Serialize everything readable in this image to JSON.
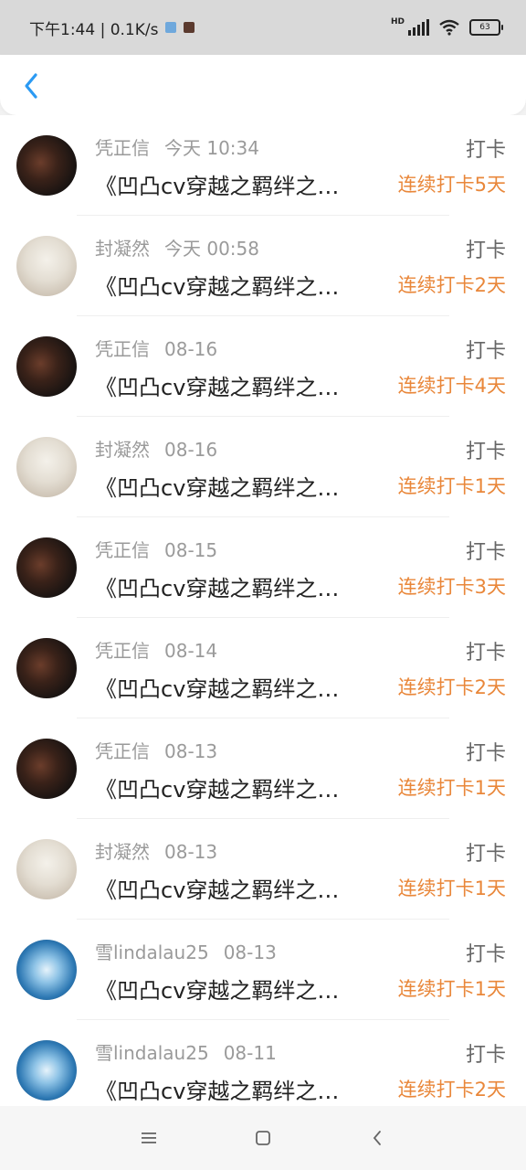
{
  "status_bar": {
    "time_speed": "下午1:44 | 0.1K/s",
    "network": "HD",
    "battery": "63"
  },
  "header": {
    "back_icon": "chevron-left-icon"
  },
  "colors": {
    "accent": "#e9873a",
    "back_icon": "#2b9af3"
  },
  "entries": [
    {
      "user": "凭正信",
      "date": "今天 10:34",
      "title": "《凹凸cv穿越之羁绊之…",
      "type": "打卡",
      "streak": "连续打卡5天",
      "avatar": "dark"
    },
    {
      "user": "封凝然",
      "date": "今天 00:58",
      "title": "《凹凸cv穿越之羁绊之…",
      "type": "打卡",
      "streak": "连续打卡2天",
      "avatar": "light"
    },
    {
      "user": "凭正信",
      "date": "08-16",
      "title": "《凹凸cv穿越之羁绊之…",
      "type": "打卡",
      "streak": "连续打卡4天",
      "avatar": "dark"
    },
    {
      "user": "封凝然",
      "date": "08-16",
      "title": "《凹凸cv穿越之羁绊之…",
      "type": "打卡",
      "streak": "连续打卡1天",
      "avatar": "light"
    },
    {
      "user": "凭正信",
      "date": "08-15",
      "title": "《凹凸cv穿越之羁绊之…",
      "type": "打卡",
      "streak": "连续打卡3天",
      "avatar": "dark"
    },
    {
      "user": "凭正信",
      "date": "08-14",
      "title": "《凹凸cv穿越之羁绊之…",
      "type": "打卡",
      "streak": "连续打卡2天",
      "avatar": "dark"
    },
    {
      "user": "凭正信",
      "date": "08-13",
      "title": "《凹凸cv穿越之羁绊之…",
      "type": "打卡",
      "streak": "连续打卡1天",
      "avatar": "dark"
    },
    {
      "user": "封凝然",
      "date": "08-13",
      "title": "《凹凸cv穿越之羁绊之…",
      "type": "打卡",
      "streak": "连续打卡1天",
      "avatar": "light"
    },
    {
      "user": "雪lindalau25",
      "date": "08-13",
      "title": "《凹凸cv穿越之羁绊之…",
      "type": "打卡",
      "streak": "连续打卡1天",
      "avatar": "snow"
    },
    {
      "user": "雪lindalau25",
      "date": "08-11",
      "title": "《凹凸cv穿越之羁绊之…",
      "type": "打卡",
      "streak": "连续打卡2天",
      "avatar": "snow"
    }
  ],
  "nav_bar": {
    "menu_icon": "menu-icon",
    "home_icon": "home-icon",
    "back_icon": "back-icon"
  }
}
